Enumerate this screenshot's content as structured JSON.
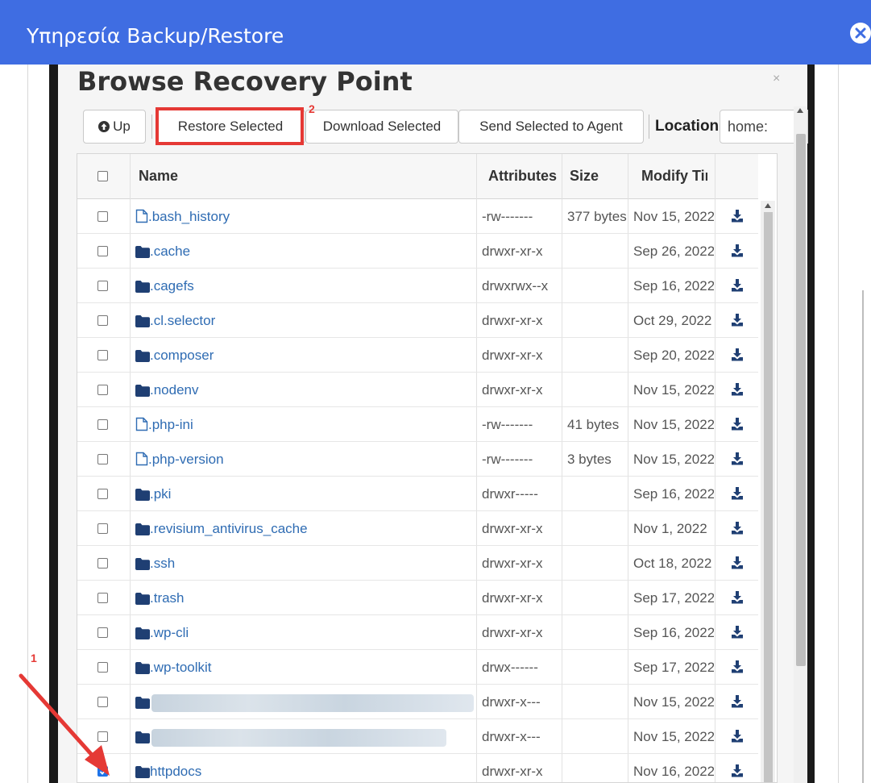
{
  "window": {
    "title": "Υπηρεσία Backup/Restore"
  },
  "modal": {
    "title": "Browse Recovery Point",
    "close_glyph": "×"
  },
  "toolbar": {
    "up_label": "Up",
    "restore_label": "Restore Selected",
    "download_label": "Download Selected",
    "send_label": "Send Selected to Agent",
    "location_label": "Location",
    "location_value": "home:"
  },
  "grid": {
    "columns": [
      "Name",
      "Attributes",
      "Size",
      "Modify Time"
    ],
    "rows": [
      {
        "name": ".bash_history",
        "type": "file",
        "attributes": "-rw-------",
        "size": "377 bytes",
        "modified": "Nov 15, 2022",
        "checked": false
      },
      {
        "name": ".cache",
        "type": "folder",
        "attributes": "drwxr-xr-x",
        "size": "",
        "modified": "Sep 26, 2022",
        "checked": false
      },
      {
        "name": ".cagefs",
        "type": "folder",
        "attributes": "drwxrwx--x",
        "size": "",
        "modified": "Sep 16, 2022",
        "checked": false
      },
      {
        "name": ".cl.selector",
        "type": "folder",
        "attributes": "drwxr-xr-x",
        "size": "",
        "modified": "Oct 29, 2022",
        "checked": false
      },
      {
        "name": ".composer",
        "type": "folder",
        "attributes": "drwxr-xr-x",
        "size": "",
        "modified": "Sep 20, 2022",
        "checked": false
      },
      {
        "name": ".nodenv",
        "type": "folder",
        "attributes": "drwxr-xr-x",
        "size": "",
        "modified": "Nov 15, 2022",
        "checked": false
      },
      {
        "name": ".php-ini",
        "type": "file",
        "attributes": "-rw-------",
        "size": "41 bytes",
        "modified": "Nov 15, 2022",
        "checked": false
      },
      {
        "name": ".php-version",
        "type": "file",
        "attributes": "-rw-------",
        "size": "3 bytes",
        "modified": "Nov 15, 2022",
        "checked": false
      },
      {
        "name": ".pki",
        "type": "folder",
        "attributes": "drwxr-----",
        "size": "",
        "modified": "Sep 16, 2022",
        "checked": false
      },
      {
        "name": ".revisium_antivirus_cache",
        "type": "folder",
        "attributes": "drwxr-xr-x",
        "size": "",
        "modified": "Nov 1, 2022",
        "checked": false
      },
      {
        "name": ".ssh",
        "type": "folder",
        "attributes": "drwxr-xr-x",
        "size": "",
        "modified": "Oct 18, 2022",
        "checked": false
      },
      {
        "name": ".trash",
        "type": "folder",
        "attributes": "drwxr-xr-x",
        "size": "",
        "modified": "Sep 17, 2022",
        "checked": false
      },
      {
        "name": ".wp-cli",
        "type": "folder",
        "attributes": "drwxr-xr-x",
        "size": "",
        "modified": "Sep 16, 2022",
        "checked": false
      },
      {
        "name": ".wp-toolkit",
        "type": "folder",
        "attributes": "drwx------",
        "size": "",
        "modified": "Sep 17, 2022",
        "checked": false
      },
      {
        "name": "",
        "type": "folder",
        "attributes": "drwxr-x---",
        "size": "",
        "modified": "Nov 15, 2022",
        "checked": false,
        "redacted": true
      },
      {
        "name": "",
        "type": "folder",
        "attributes": "drwxr-x---",
        "size": "",
        "modified": "Nov 15, 2022",
        "checked": false,
        "redacted": true
      },
      {
        "name": "httpdocs",
        "type": "folder",
        "attributes": "drwxr-xr-x",
        "size": "",
        "modified": "Nov 16, 2022",
        "checked": true
      }
    ]
  },
  "annotations": {
    "step1": "1",
    "step2": "2"
  },
  "colors": {
    "titlebar": "#3f6de2",
    "link": "#2f6cb3",
    "highlight": "#e53935",
    "checkbox_checked": "#1e73e8"
  },
  "icons": [
    "close-circle-icon",
    "arrow-up-circle-icon",
    "file-icon",
    "folder-icon",
    "download-icon"
  ]
}
